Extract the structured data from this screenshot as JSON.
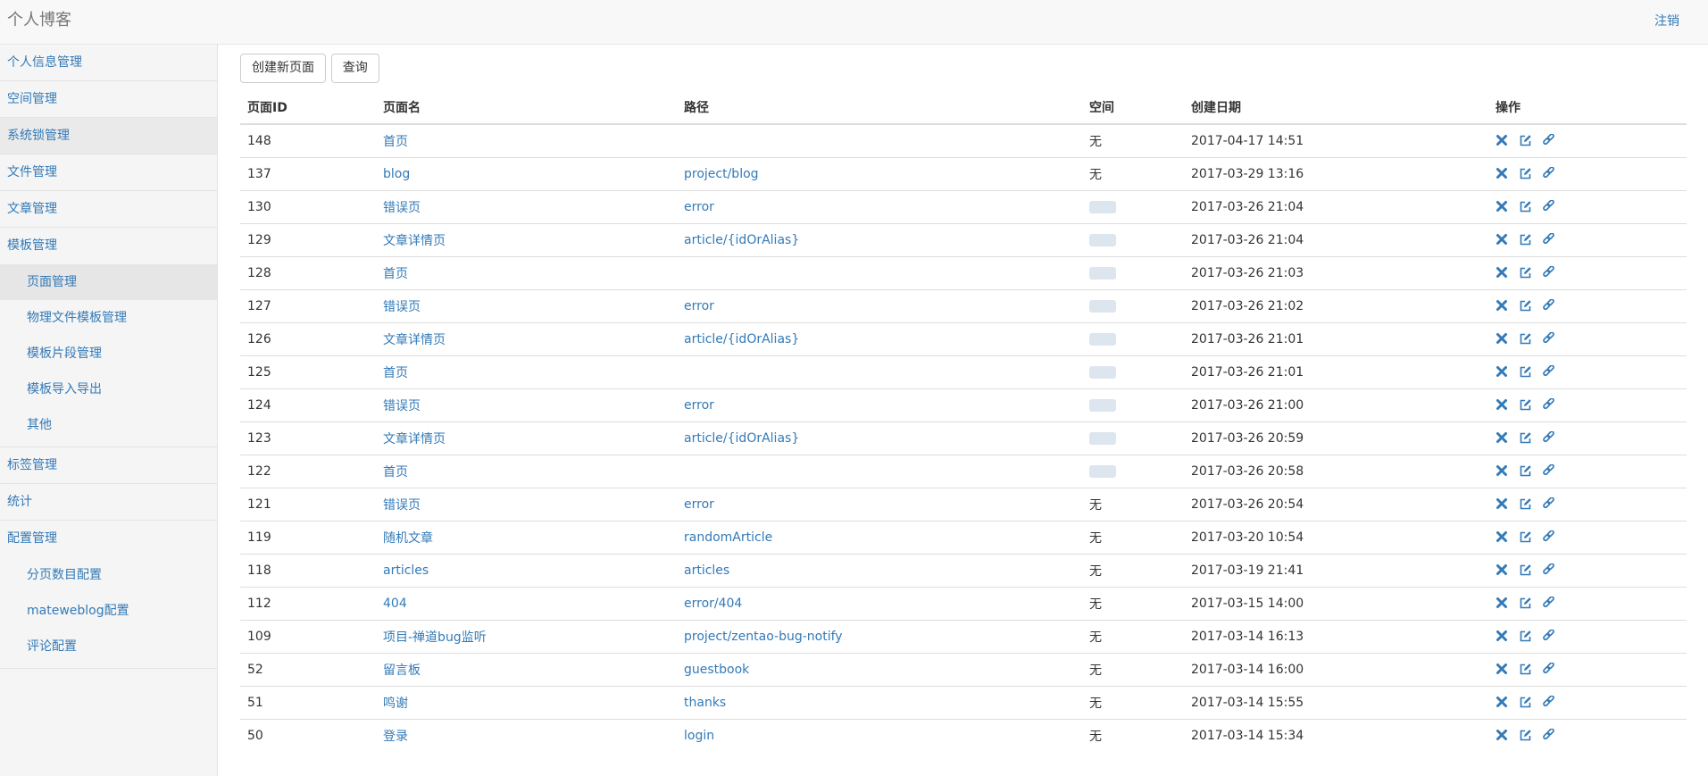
{
  "navbar": {
    "brand": "个人博客",
    "logout": "注销"
  },
  "sidebar": {
    "items": [
      {
        "id": "profile",
        "label": "个人信息管理"
      },
      {
        "id": "space",
        "label": "空间管理"
      },
      {
        "id": "lock",
        "label": "系统锁管理"
      },
      {
        "id": "file",
        "label": "文件管理"
      },
      {
        "id": "article",
        "label": "文章管理"
      }
    ],
    "template_group": {
      "label": "模板管理",
      "children": [
        "页面管理",
        "物理文件模板管理",
        "模板片段管理",
        "模板导入导出",
        "其他"
      ]
    },
    "items2": [
      {
        "id": "tag",
        "label": "标签管理"
      },
      {
        "id": "stats",
        "label": "统计"
      }
    ],
    "config_group": {
      "label": "配置管理",
      "children": [
        "分页数目配置",
        "mateweblog配置",
        "评论配置"
      ]
    }
  },
  "toolbar": {
    "create_label": "创建新页面",
    "query_label": "查询"
  },
  "table": {
    "headers": [
      "页面ID",
      "页面名",
      "路径",
      "空间",
      "创建日期",
      "操作"
    ],
    "rows": [
      {
        "id": "148",
        "name": "首页",
        "path": "",
        "space": "无",
        "date": "2017-04-17 14:51"
      },
      {
        "id": "137",
        "name": "blog",
        "path": "project/blog",
        "space": "无",
        "date": "2017-03-29 13:16"
      },
      {
        "id": "130",
        "name": "错误页",
        "path": "error",
        "space": "",
        "date": "2017-03-26 21:04"
      },
      {
        "id": "129",
        "name": "文章详情页",
        "path": "article/{idOrAlias}",
        "space": "",
        "date": "2017-03-26 21:04"
      },
      {
        "id": "128",
        "name": "首页",
        "path": "",
        "space": "",
        "date": "2017-03-26 21:03"
      },
      {
        "id": "127",
        "name": "错误页",
        "path": "error",
        "space": "",
        "date": "2017-03-26 21:02"
      },
      {
        "id": "126",
        "name": "文章详情页",
        "path": "article/{idOrAlias}",
        "space": "",
        "date": "2017-03-26 21:01"
      },
      {
        "id": "125",
        "name": "首页",
        "path": "",
        "space": "",
        "date": "2017-03-26 21:01"
      },
      {
        "id": "124",
        "name": "错误页",
        "path": "error",
        "space": "",
        "date": "2017-03-26 21:00"
      },
      {
        "id": "123",
        "name": "文章详情页",
        "path": "article/{idOrAlias}",
        "space": "",
        "date": "2017-03-26 20:59"
      },
      {
        "id": "122",
        "name": "首页",
        "path": "",
        "space": "",
        "date": "2017-03-26 20:58"
      },
      {
        "id": "121",
        "name": "错误页",
        "path": "error",
        "space": "无",
        "date": "2017-03-26 20:54"
      },
      {
        "id": "119",
        "name": "随机文章",
        "path": "randomArticle",
        "space": "无",
        "date": "2017-03-20 10:54"
      },
      {
        "id": "118",
        "name": "articles",
        "path": "articles",
        "space": "无",
        "date": "2017-03-19 21:41"
      },
      {
        "id": "112",
        "name": "404",
        "path": "error/404",
        "space": "无",
        "date": "2017-03-15 14:00"
      },
      {
        "id": "109",
        "name": "项目-禅道bug监听",
        "path": "project/zentao-bug-notify",
        "space": "无",
        "date": "2017-03-14 16:13"
      },
      {
        "id": "52",
        "name": "留言板",
        "path": "guestbook",
        "space": "无",
        "date": "2017-03-14 16:00"
      },
      {
        "id": "51",
        "name": "鸣谢",
        "path": "thanks",
        "space": "无",
        "date": "2017-03-14 15:55"
      },
      {
        "id": "50",
        "name": "登录",
        "path": "login",
        "space": "无",
        "date": "2017-03-14 15:34"
      }
    ]
  },
  "icons": {
    "delete": "remove-icon",
    "edit": "edit-icon",
    "link": "link-icon"
  },
  "colors": {
    "link": "#337ab7",
    "navbar_bg": "#f8f8f8",
    "sidebar_bg": "#f5f5f5"
  }
}
